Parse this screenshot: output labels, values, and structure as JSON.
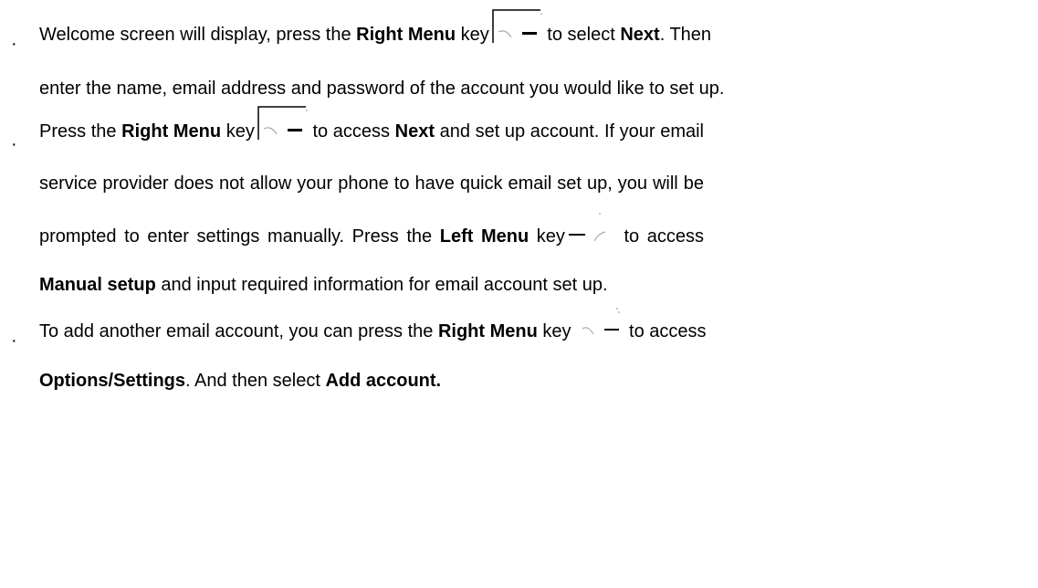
{
  "document": {
    "bullet_symbol": "·",
    "items": [
      {
        "lines": [
          {
            "t1": "Welcome screen will display, press the ",
            "b1": "Right Menu",
            "t2": " key",
            "icon": "right-menu-key-icon",
            "t3": " to select ",
            "b2": "Next",
            "t4": ". Then"
          },
          {
            "t1": "enter the name, email address and password of the account you would like to set up."
          }
        ]
      },
      {
        "lines": [
          {
            "t1": "Press the ",
            "b1": "Right Menu",
            "t2": " key",
            "icon": "right-menu-key-icon",
            "t3": " to access ",
            "b2": "Next",
            "t4": " and set up account. If your email"
          },
          {
            "t1": "service provider does not allow your phone to have quick email set up, you will be"
          },
          {
            "t1": "prompted to enter settings manually. Press the ",
            "b1": "Left Menu",
            "t2": " key",
            "icon": "left-menu-key-icon",
            "t3": " to access"
          },
          {
            "b1": "Manual setup",
            "t1": " and input required information for email account set up."
          }
        ]
      },
      {
        "lines": [
          {
            "t1": "To add another email account, you can press the ",
            "b1": "Right Menu",
            "t2": " key",
            "icon": "right-menu-key-icon",
            "t3": " to access"
          },
          {
            "b1": "Options/Settings",
            "t1": ". And then select ",
            "b2": "Add account."
          }
        ]
      }
    ]
  }
}
